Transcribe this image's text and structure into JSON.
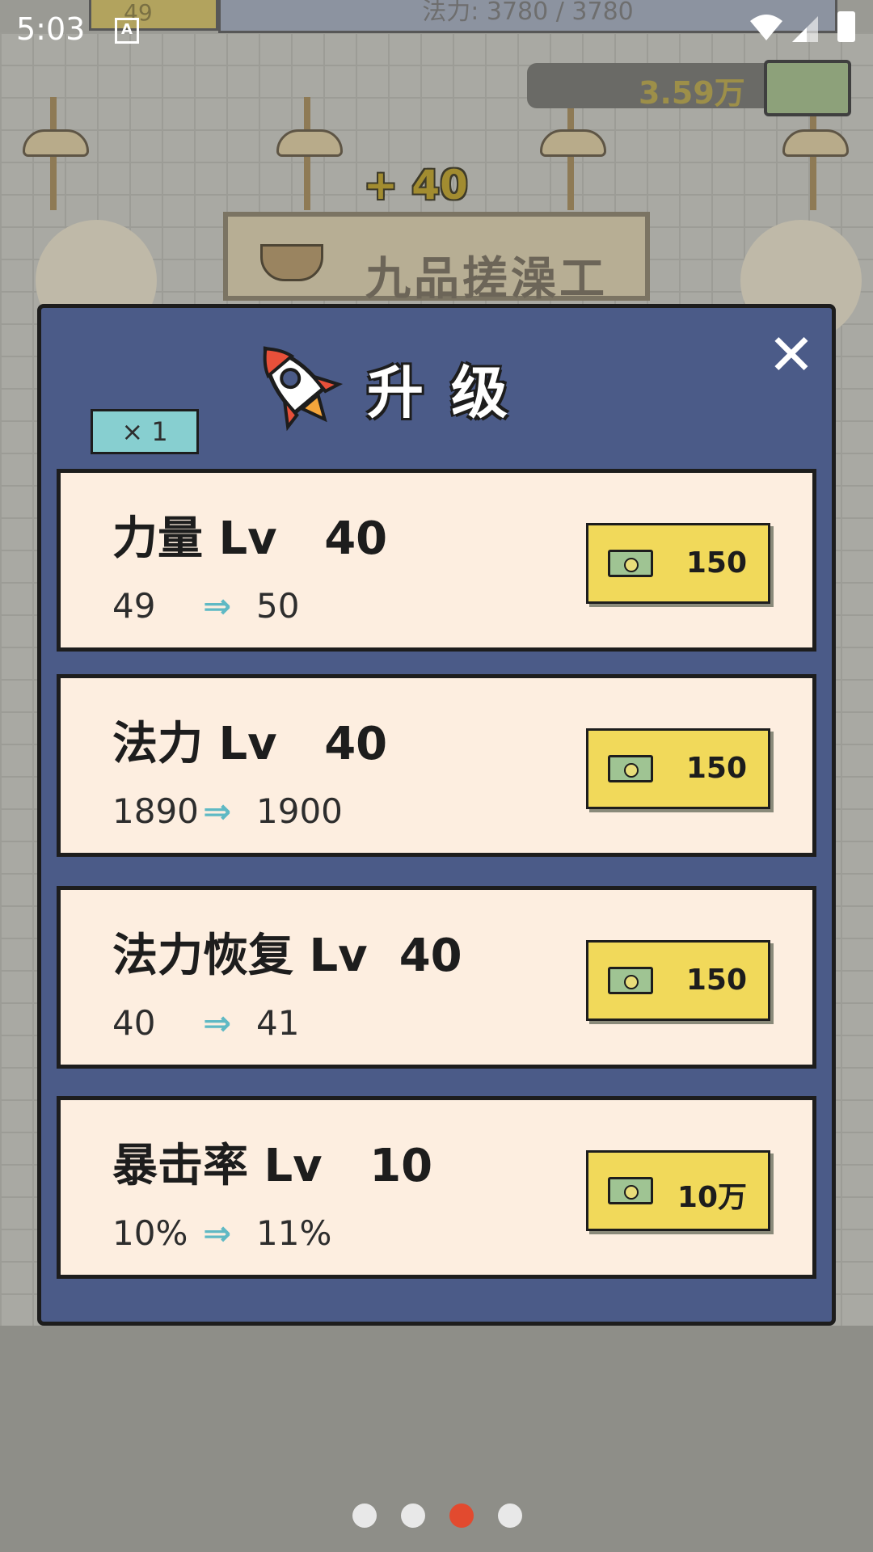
{
  "status_bar": {
    "time": "5:03",
    "notification_icon": "A",
    "icons": [
      "wifi-icon",
      "signal-icon",
      "battery-icon"
    ]
  },
  "background": {
    "hp_value": "49",
    "mana_label": "法力: 3780 / 3780",
    "money": "3.59万",
    "gain_popup": "+ 40",
    "job_title": "九品搓澡工"
  },
  "upgrade_modal": {
    "title": "升级",
    "multiplier": "× 1",
    "close_icon": "close-icon",
    "items": [
      {
        "name": "力量",
        "level_text": "Lv",
        "level": "40",
        "from": "49",
        "to": "50",
        "price": "150"
      },
      {
        "name": "法力",
        "level_text": "Lv",
        "level": "40",
        "from": "1890",
        "to": "1900",
        "price": "150"
      },
      {
        "name": "法力恢复",
        "level_text": "Lv",
        "level": "40",
        "from": "40",
        "to": "41",
        "price": "150"
      },
      {
        "name": "暴击率",
        "level_text": "Lv",
        "level": "10",
        "from": "10%",
        "to": "11%",
        "price": "10万"
      }
    ]
  },
  "pagination": {
    "total": 4,
    "active_index": 3,
    "active_color": "#e24a2f",
    "inactive_color": "#e8e8e8"
  },
  "colors": {
    "modal_bg": "#4b5b88",
    "card_bg": "#fdeee0",
    "button_bg": "#f1d95a",
    "multiplier_bg": "#87cfd0"
  }
}
